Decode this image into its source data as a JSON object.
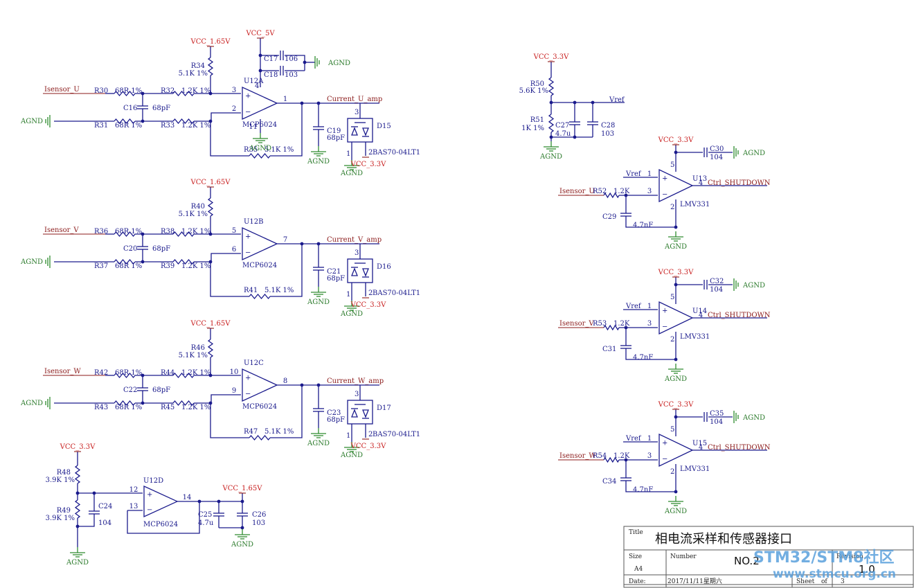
{
  "nets": {
    "vcc165": "VCC_1.65V",
    "vcc5": "VCC_5V",
    "vcc33": "VCC_3.3V",
    "agnd": "AGND",
    "vref": "Vref",
    "isensor_u": "Isensor_U",
    "isensor_v": "Isensor_V",
    "isensor_w": "Isensor_W",
    "current_u": "Current_U_amp",
    "current_v": "Current_V_amp",
    "current_w": "Current_W_amp",
    "ctrl_shutdown": "Ctrl_SHUTDOWN"
  },
  "channel_u": {
    "r_top": {
      "ref": "R34",
      "val": "5.1K 1%"
    },
    "r_in1": {
      "ref": "R30",
      "val": "68R 1%"
    },
    "r_in2": {
      "ref": "R32",
      "val": "1.2K 1%"
    },
    "r_gnd1": {
      "ref": "R31",
      "val": "68R 1%"
    },
    "r_gnd2": {
      "ref": "R33",
      "val": "1.2K 1%"
    },
    "r_fb": {
      "ref": "R35",
      "val": "5.1K 1%"
    },
    "c_in": {
      "ref": "C16",
      "val": "68pF"
    },
    "c_out": {
      "ref": "C19",
      "val": "68pF"
    },
    "c_dec1": {
      "ref": "C17",
      "val": "106"
    },
    "c_dec2": {
      "ref": "C18",
      "val": "103"
    },
    "opamp": {
      "ref": "U12A",
      "val": "MCP6024"
    },
    "diode": {
      "ref": "D15",
      "val": "BAS70-04LT1"
    },
    "pins": {
      "p": "3",
      "n": "2",
      "out": "1",
      "vcc": "4",
      "gnd": "11",
      "d3": "3",
      "d1": "1",
      "d2": "2"
    }
  },
  "channel_v": {
    "r_top": {
      "ref": "R40",
      "val": "5.1K 1%"
    },
    "r_in1": {
      "ref": "R36",
      "val": "68R 1%"
    },
    "r_in2": {
      "ref": "R38",
      "val": "1.2K 1%"
    },
    "r_gnd1": {
      "ref": "R37",
      "val": "68R 1%"
    },
    "r_gnd2": {
      "ref": "R39",
      "val": "1.2K 1%"
    },
    "r_fb": {
      "ref": "R41",
      "val": "5.1K 1%"
    },
    "c_in": {
      "ref": "C20",
      "val": "68pF"
    },
    "c_out": {
      "ref": "C21",
      "val": "68pF"
    },
    "opamp": {
      "ref": "U12B",
      "val": "MCP6024"
    },
    "diode": {
      "ref": "D16",
      "val": "BAS70-04LT1"
    },
    "pins": {
      "p": "5",
      "n": "6",
      "out": "7",
      "d3": "3",
      "d1": "1",
      "d2": "2"
    }
  },
  "channel_w": {
    "r_top": {
      "ref": "R46",
      "val": "5.1K 1%"
    },
    "r_in1": {
      "ref": "R42",
      "val": "68R 1%"
    },
    "r_in2": {
      "ref": "R44",
      "val": "1.2K 1%"
    },
    "r_gnd1": {
      "ref": "R43",
      "val": "68R 1%"
    },
    "r_gnd2": {
      "ref": "R45",
      "val": "1.2K 1%"
    },
    "r_fb": {
      "ref": "R47",
      "val": "5.1K 1%"
    },
    "c_in": {
      "ref": "C22",
      "val": "68pF"
    },
    "c_out": {
      "ref": "C23",
      "val": "68pF"
    },
    "opamp": {
      "ref": "U12C",
      "val": "MCP6024"
    },
    "diode": {
      "ref": "D17",
      "val": "BAS70-04LT1"
    },
    "pins": {
      "p": "10",
      "n": "9",
      "out": "8",
      "d3": "3",
      "d1": "1",
      "d2": "2"
    }
  },
  "ref_buffer": {
    "r_top": {
      "ref": "R48",
      "val": "3.9K 1%"
    },
    "r_bot": {
      "ref": "R49",
      "val": "3.9K 1%"
    },
    "c_div": {
      "ref": "C24",
      "val": "104"
    },
    "opamp": {
      "ref": "U12D",
      "val": "MCP6024"
    },
    "c_out1": {
      "ref": "C25",
      "val": "4.7u"
    },
    "c_out2": {
      "ref": "C26",
      "val": "103"
    },
    "pins": {
      "p": "12",
      "n": "13",
      "out": "14"
    }
  },
  "vref_div": {
    "r_top": {
      "ref": "R50",
      "val": "5.6K 1%"
    },
    "r_bot": {
      "ref": "R51",
      "val": "1K 1%"
    },
    "c1": {
      "ref": "C27",
      "val": "4.7u"
    },
    "c2": {
      "ref": "C28",
      "val": "103"
    }
  },
  "comparators": [
    {
      "ref": "U13",
      "val": "LMV331",
      "r": "R52",
      "r_val": "1.2K",
      "c": "C29",
      "c_val": "4.7nF",
      "cd": "C30",
      "cd_val": "104",
      "input_key": "isensor_u",
      "pins": {
        "p": "1",
        "n": "3",
        "out": "4",
        "vcc": "5",
        "gnd": "2"
      }
    },
    {
      "ref": "U14",
      "val": "LMV331",
      "r": "R53",
      "r_val": "1.2K",
      "c": "C31",
      "c_val": "4.7nF",
      "cd": "C32",
      "cd_val": "104",
      "input_key": "isensor_v",
      "pins": {
        "p": "1",
        "n": "3",
        "out": "4",
        "vcc": "5",
        "gnd": "2"
      }
    },
    {
      "ref": "U15",
      "val": "LMV331",
      "r": "R54",
      "r_val": "1.2K",
      "c": "C34",
      "c_val": "4.7nF",
      "cd": "C35",
      "cd_val": "104",
      "input_key": "isensor_w",
      "pins": {
        "p": "1",
        "n": "3",
        "out": "4",
        "vcc": "5",
        "gnd": "2"
      }
    }
  ],
  "title_block": {
    "title_label": "Title",
    "title": "相电流采样和传感器接口",
    "size_label": "Size",
    "size": "A4",
    "number_label": "Number",
    "number": "NO.2",
    "revision_label": "Revision",
    "revision": "1.0",
    "date_label": "Date:",
    "date": "2017/11/11星期六",
    "sheet_label": "Sheet",
    "of_label": "of",
    "sheet_total": "3"
  },
  "watermark": {
    "line1": "STM32/STM8社区",
    "line2": "www.stmcu.org.cn"
  }
}
